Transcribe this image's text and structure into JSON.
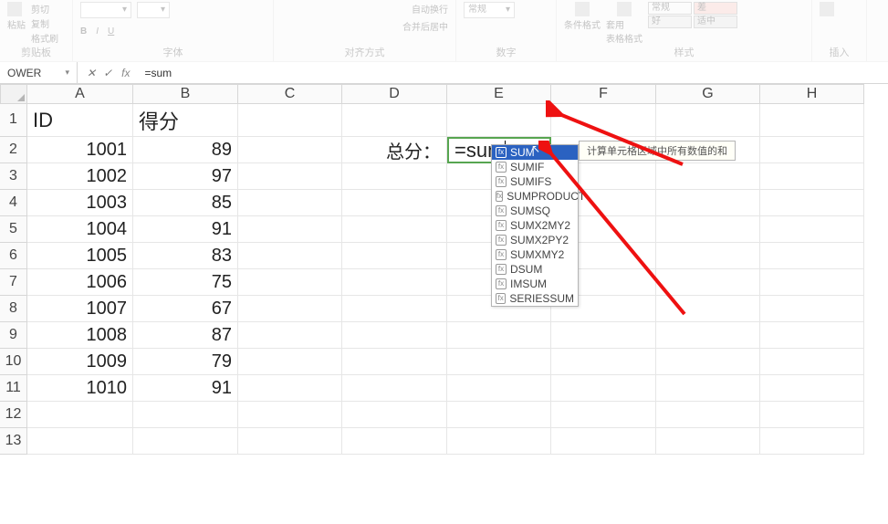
{
  "ribbon": {
    "clipboard": {
      "cut": "剪切",
      "copy": "复制",
      "format_painter": "格式刷",
      "paste": "粘贴",
      "label": "剪贴板"
    },
    "font": {
      "wrap": "自动换行",
      "merge": "合并后居中",
      "label": "字体",
      "bold": "B",
      "italic": "I",
      "underline": "U"
    },
    "align": {
      "label": "对齐方式"
    },
    "number": {
      "format": "常规",
      "label": "数字"
    },
    "styles": {
      "cond": "条件格式",
      "table": "套用\n表格格式",
      "normal": "常规",
      "bad": "差",
      "good": "好",
      "neutral": "适中",
      "label": "样式"
    },
    "cells": {
      "insert": "插入"
    }
  },
  "formulaBar": {
    "nameBox": "OWER",
    "cancel": "✕",
    "enter": "✓",
    "fx": "fx",
    "formula": "=sum"
  },
  "columns": [
    "A",
    "B",
    "C",
    "D",
    "E",
    "F",
    "G",
    "H"
  ],
  "rows": [
    "1",
    "2",
    "3",
    "4",
    "5",
    "6",
    "7",
    "8",
    "9",
    "10",
    "11",
    "12",
    "13"
  ],
  "grid": {
    "A1": "ID",
    "B1": "得分",
    "D2": "总分：",
    "E2": "=sum",
    "colA": [
      "1001",
      "1002",
      "1003",
      "1004",
      "1005",
      "1006",
      "1007",
      "1008",
      "1009",
      "1010"
    ],
    "colB": [
      "89",
      "97",
      "85",
      "91",
      "83",
      "75",
      "67",
      "87",
      "79",
      "91"
    ]
  },
  "autocomplete": {
    "items": [
      "SUM",
      "SUMIF",
      "SUMIFS",
      "SUMPRODUCT",
      "SUMSQ",
      "SUMX2MY2",
      "SUMX2PY2",
      "SUMXMY2",
      "DSUM",
      "IMSUM",
      "SERIESSUM"
    ],
    "selectedIndex": 0,
    "tooltip": "计算单元格区域中所有数值的和"
  }
}
